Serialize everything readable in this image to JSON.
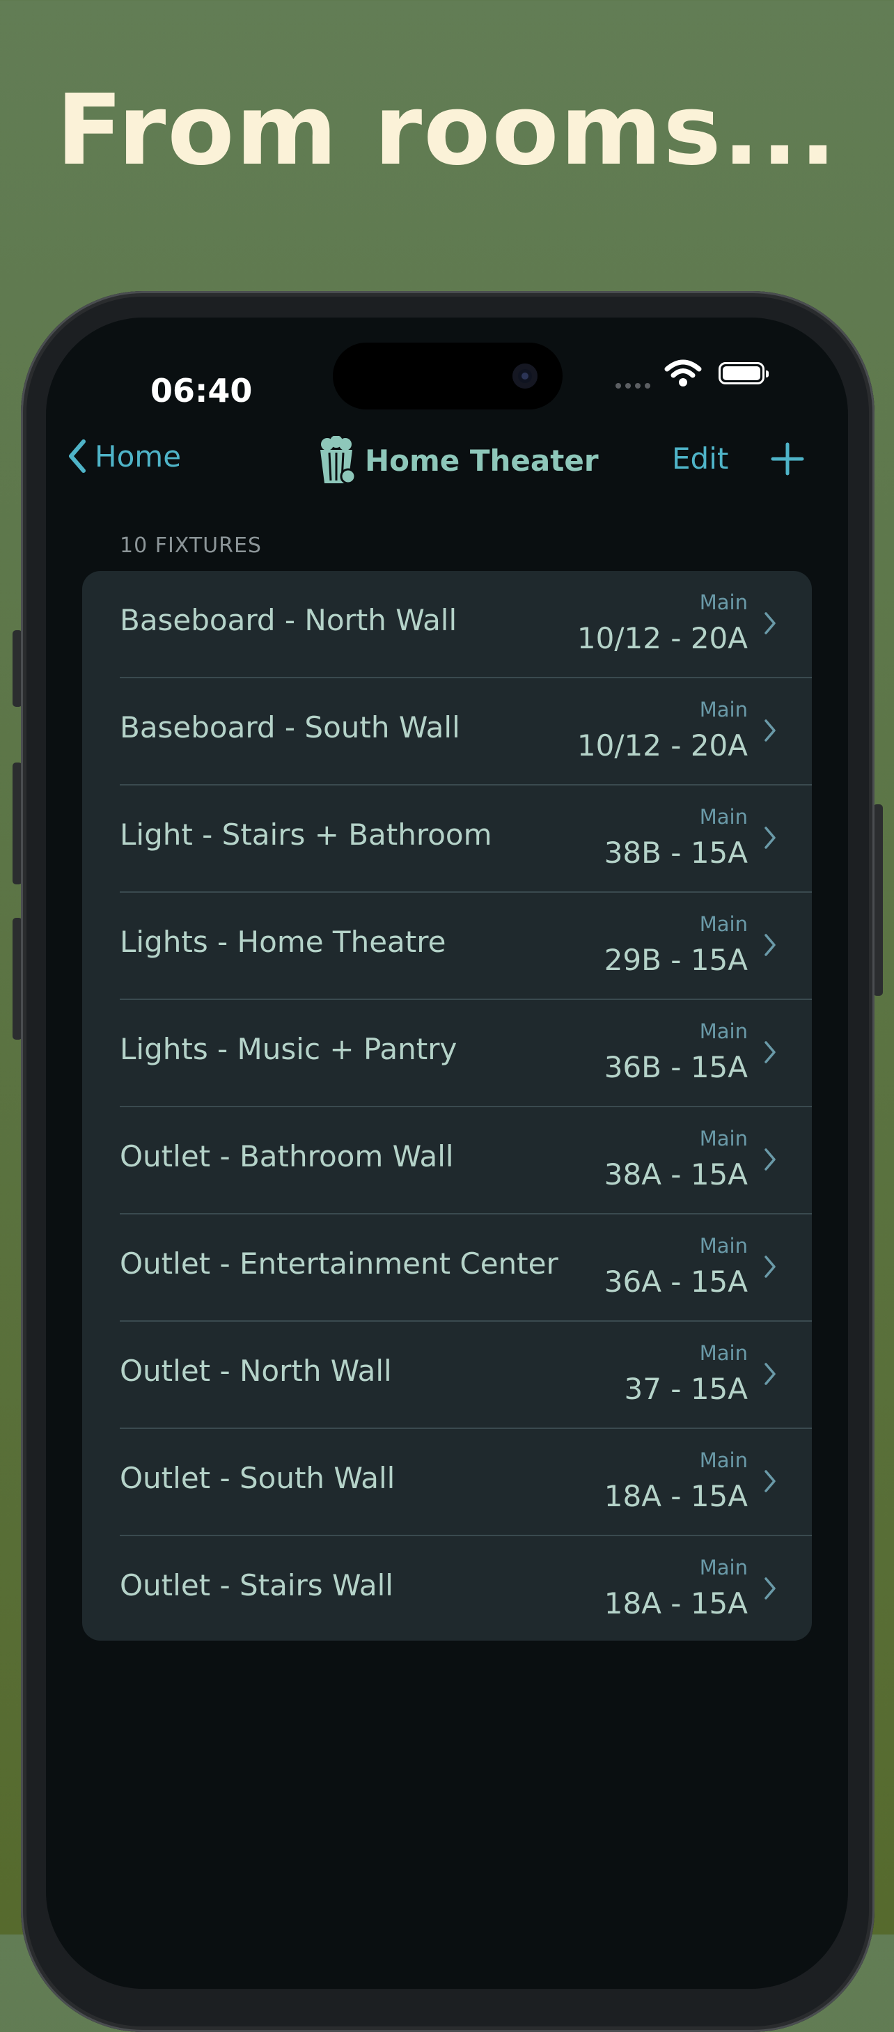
{
  "headline": "From rooms...",
  "status_bar": {
    "time": "06:40"
  },
  "nav": {
    "back_label": "Home",
    "title": "Home Theater",
    "edit_label": "Edit",
    "room_icon": "popcorn-icon",
    "add_icon": "plus-icon"
  },
  "section": {
    "header": "10 FIXTURES"
  },
  "fixtures": [
    {
      "name": "Baseboard - North Wall",
      "panel": "Main",
      "circuit": "10/12 - 20A"
    },
    {
      "name": "Baseboard - South Wall",
      "panel": "Main",
      "circuit": "10/12 - 20A"
    },
    {
      "name": "Light - Stairs + Bathroom",
      "panel": "Main",
      "circuit": "38B - 15A"
    },
    {
      "name": "Lights - Home Theatre",
      "panel": "Main",
      "circuit": "29B - 15A"
    },
    {
      "name": "Lights - Music + Pantry",
      "panel": "Main",
      "circuit": "36B - 15A"
    },
    {
      "name": "Outlet - Bathroom Wall",
      "panel": "Main",
      "circuit": "38A - 15A"
    },
    {
      "name": "Outlet - Entertainment Center",
      "panel": "Main",
      "circuit": "36A - 15A"
    },
    {
      "name": "Outlet - North Wall",
      "panel": "Main",
      "circuit": "37 - 15A"
    },
    {
      "name": "Outlet - South Wall",
      "panel": "Main",
      "circuit": "18A - 15A"
    },
    {
      "name": "Outlet - Stairs Wall",
      "panel": "Main",
      "circuit": "18A - 15A"
    }
  ],
  "colors": {
    "accent": "#4fb4c8",
    "title_text": "#8ec7ba",
    "row_text": "#b5d3c9",
    "background": "#0a0f11",
    "card": "#1f292d"
  }
}
